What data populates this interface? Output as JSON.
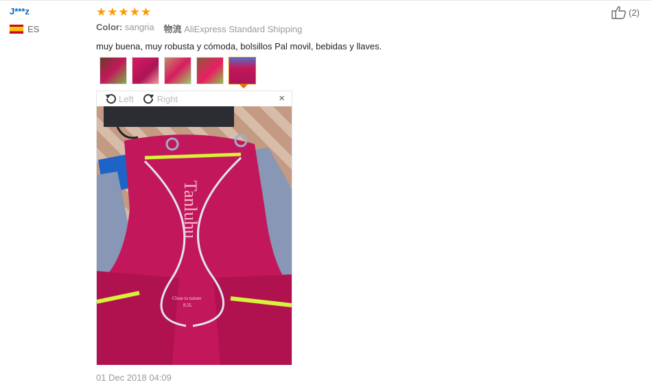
{
  "reviewer": {
    "name": "J***z",
    "country_code": "ES"
  },
  "rating": {
    "stars": 5,
    "max": 5
  },
  "attributes": {
    "color_label": "Color:",
    "color_value": "sangria",
    "shipping_label": "物流",
    "shipping_value": "AliExpress Standard Shipping"
  },
  "review_text": "muy buena, muy robusta y cómoda, bolsillos Pal movil, bebidas y llaves.",
  "thumbnails": [
    {
      "name": "thumb-1"
    },
    {
      "name": "thumb-2"
    },
    {
      "name": "thumb-3"
    },
    {
      "name": "thumb-4"
    },
    {
      "name": "thumb-5",
      "selected": true
    }
  ],
  "viewer": {
    "rotate_left_label": "Left",
    "rotate_right_label": "Right",
    "close_glyph": "×"
  },
  "photo_text": {
    "brand": "Tanluhu",
    "tag1": "Close to nature",
    "tag2": "8.5L"
  },
  "date": "01 Dec 2018 04:09",
  "helpful": {
    "count_text": "(2)"
  },
  "colors": {
    "accent_orange": "#ff9900",
    "link_blue": "#0066c0",
    "selected_border": "#e37400",
    "pack_pink": "#c2185b"
  }
}
